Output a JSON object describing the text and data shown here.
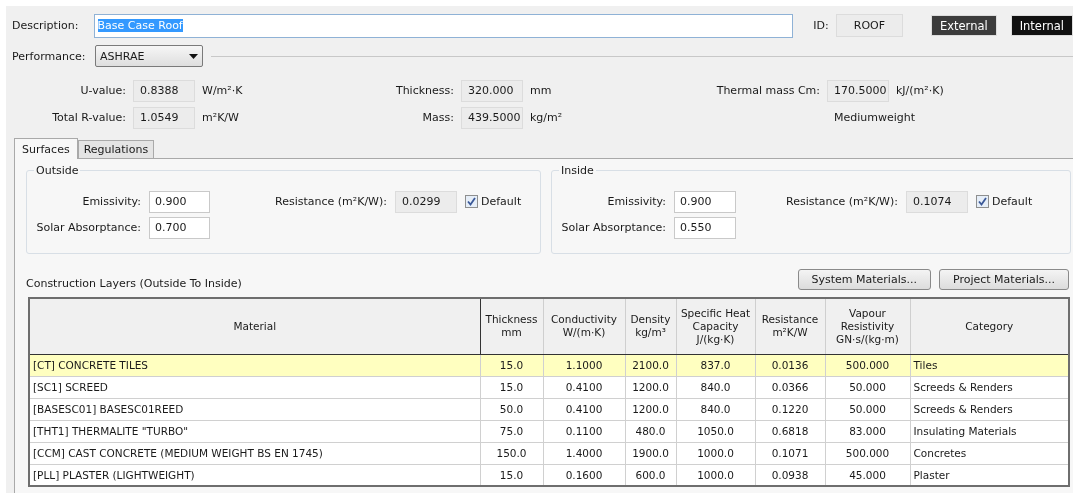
{
  "description": {
    "label": "Description:",
    "value": "Base Case Roof"
  },
  "id": {
    "label": "ID:",
    "value": "ROOF"
  },
  "mode_buttons": [
    {
      "label": "External",
      "selected": false
    },
    {
      "label": "Internal",
      "selected": true
    }
  ],
  "performance": {
    "label": "Performance:",
    "value": "ASHRAE"
  },
  "property_columns": [
    [
      {
        "label": "U-value:",
        "value": "0.8388",
        "unit": "W/m²·K"
      },
      {
        "label": "Total R-value:",
        "value": "1.0549",
        "unit": "m²K/W"
      }
    ],
    [
      {
        "label": "Thickness:",
        "value": "320.000",
        "unit": "mm"
      },
      {
        "label": "Mass:",
        "value": "439.5000",
        "unit": "kg/m²"
      }
    ],
    [
      {
        "label": "Thermal mass Cm:",
        "value": "170.5000",
        "unit": "kJ/(m²·K)"
      }
    ]
  ],
  "weight_class": "Mediumweight",
  "tabs": [
    {
      "label": "Surfaces",
      "selected": true
    },
    {
      "label": "Regulations",
      "selected": false
    }
  ],
  "surfaces": [
    {
      "title": "Outside",
      "emissivity": {
        "label": "Emissivity:",
        "value": "0.900"
      },
      "solar_absorptance": {
        "label": "Solar Absorptance:",
        "value": "0.700"
      },
      "resistance": {
        "label": "Resistance (m²K/W):",
        "value": "0.0299"
      },
      "default": {
        "label": "Default",
        "checked": true
      }
    },
    {
      "title": "Inside",
      "emissivity": {
        "label": "Emissivity:",
        "value": "0.900"
      },
      "solar_absorptance": {
        "label": "Solar Absorptance:",
        "value": "0.550"
      },
      "resistance": {
        "label": "Resistance (m²K/W):",
        "value": "0.1074"
      },
      "default": {
        "label": "Default",
        "checked": true
      }
    }
  ],
  "layers": {
    "title": "Construction Layers (Outside To Inside)",
    "buttons": [
      "System Materials...",
      "Project Materials..."
    ],
    "columns": [
      "Material",
      "Thickness\nmm",
      "Conductivity\nW/(m·K)",
      "Density\nkg/m³",
      "Specific Heat\nCapacity\nJ/(kg·K)",
      "Resistance\nm²K/W",
      "Vapour\nResistivity\nGN·s/(kg·m)",
      "Category"
    ],
    "rows": [
      {
        "selected": true,
        "cells": [
          "[CT] CONCRETE TILES",
          "15.0",
          "1.1000",
          "2100.0",
          "837.0",
          "0.0136",
          "500.000",
          "Tiles"
        ]
      },
      {
        "selected": false,
        "cells": [
          "[SC1] SCREED",
          "15.0",
          "0.4100",
          "1200.0",
          "840.0",
          "0.0366",
          "50.000",
          "Screeds & Renders"
        ]
      },
      {
        "selected": false,
        "cells": [
          "[BASESC01] BASESC01REED",
          "50.0",
          "0.4100",
          "1200.0",
          "840.0",
          "0.1220",
          "50.000",
          "Screeds & Renders"
        ]
      },
      {
        "selected": false,
        "cells": [
          "[THT1] THERMALITE \"TURBO\"",
          "75.0",
          "0.1100",
          "480.0",
          "1050.0",
          "0.6818",
          "83.000",
          "Insulating Materials"
        ]
      },
      {
        "selected": false,
        "cells": [
          "[CCM] CAST CONCRETE (MEDIUM WEIGHT BS EN 1745)",
          "150.0",
          "1.4000",
          "1900.0",
          "1000.0",
          "0.1071",
          "500.000",
          "Concretes"
        ]
      },
      {
        "selected": false,
        "cells": [
          "[PLL] PLASTER (LIGHTWEIGHT)",
          "15.0",
          "0.1600",
          "600.0",
          "1000.0",
          "0.0938",
          "45.000",
          "Plaster"
        ]
      }
    ]
  }
}
